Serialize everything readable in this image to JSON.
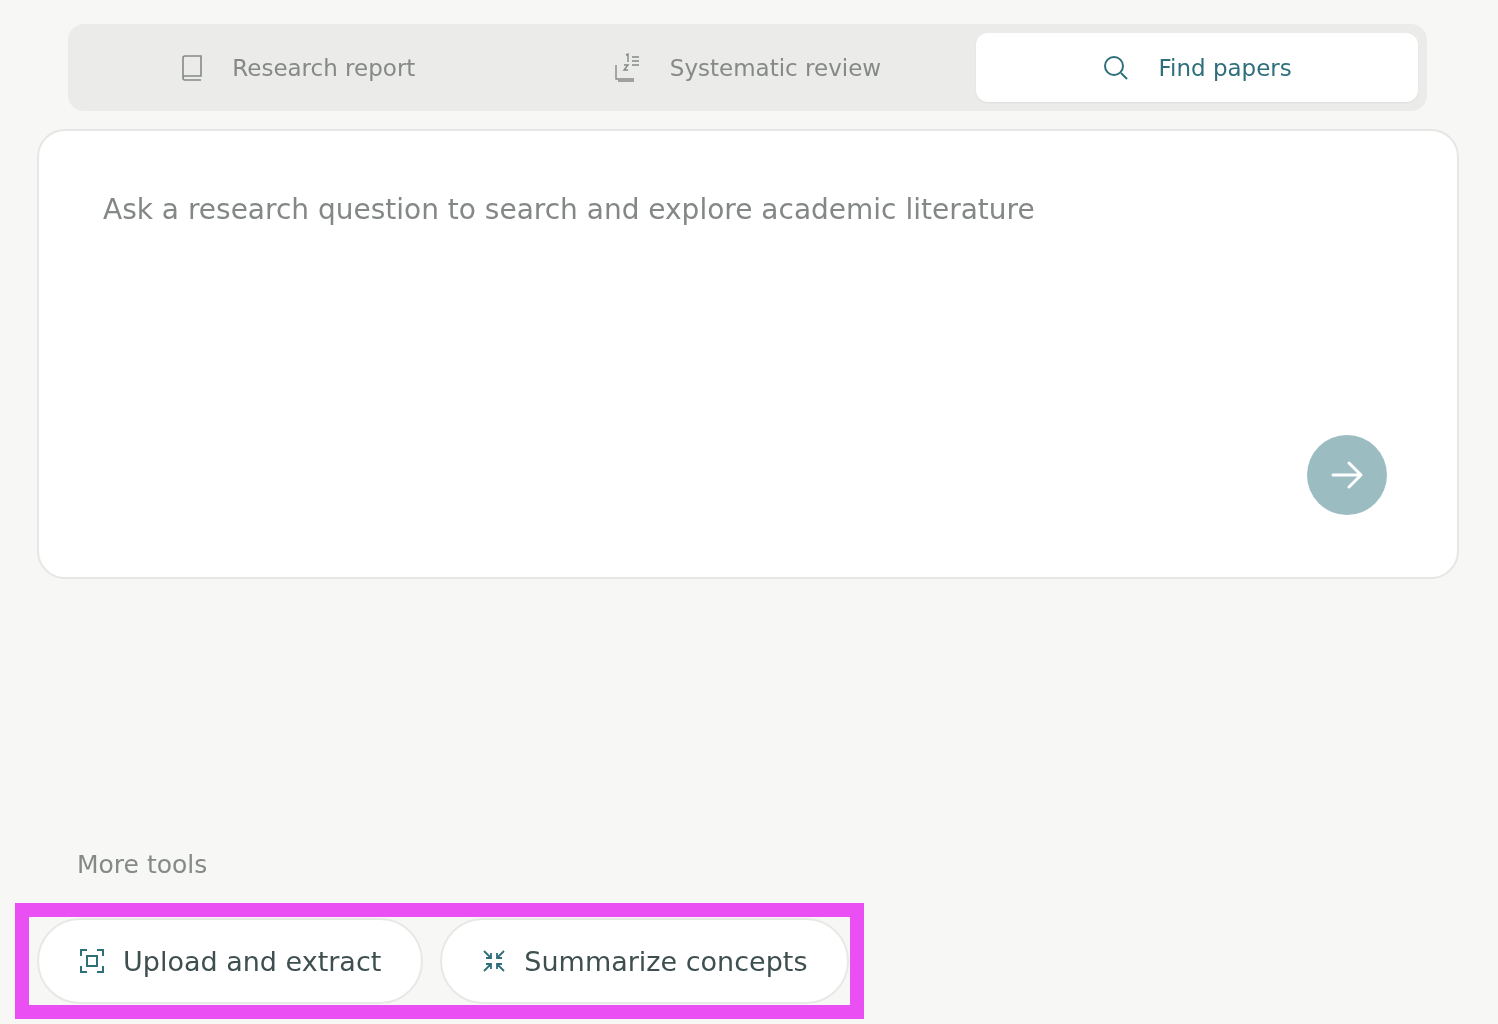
{
  "tabs": [
    {
      "kind": "report",
      "label": "Research report",
      "selected": false
    },
    {
      "kind": "review",
      "label": "Systematic review",
      "selected": false
    },
    {
      "kind": "search",
      "label": "Find papers",
      "selected": true
    }
  ],
  "query": {
    "placeholder": "Ask a research question to search and explore academic literature",
    "send_button": {
      "disabled": true
    }
  },
  "more_tools": {
    "title": "More tools",
    "highlighted": true,
    "buttons": [
      {
        "kind": "extract",
        "label": "Upload and extract"
      },
      {
        "kind": "summarize",
        "label": "Summarize concepts"
      }
    ]
  }
}
